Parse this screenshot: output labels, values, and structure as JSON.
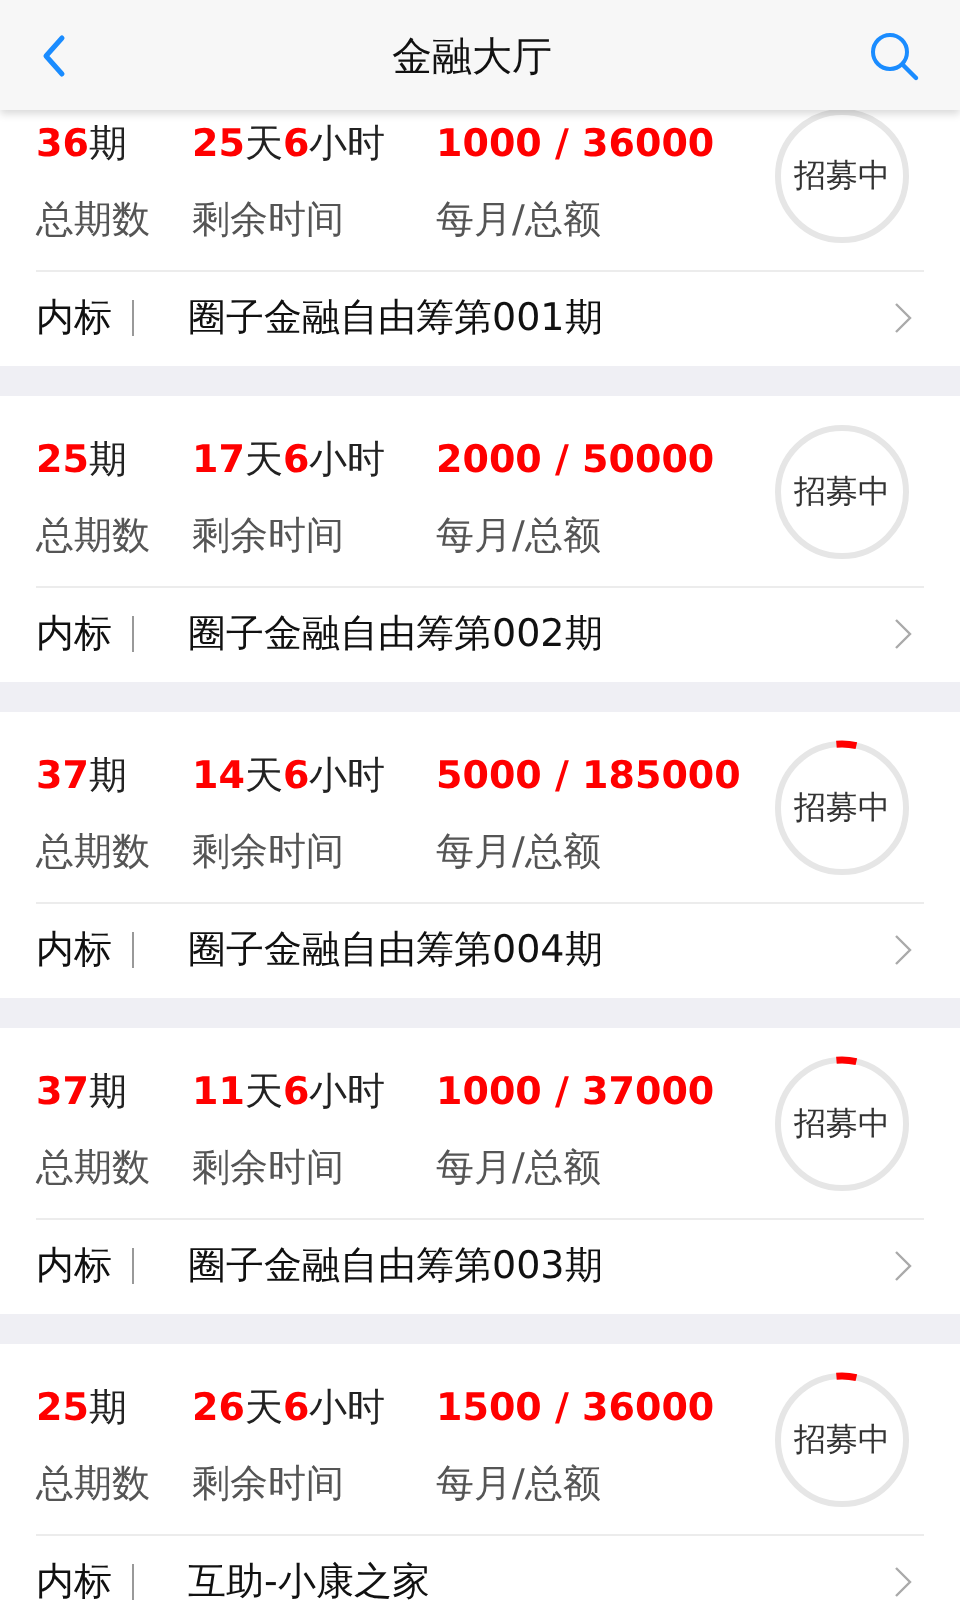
{
  "header": {
    "title": "金融大厅"
  },
  "items": [
    {
      "periods": [
        "36",
        "期"
      ],
      "remaining": [
        "25",
        "天",
        "6",
        "小时"
      ],
      "amount": "1000 / 36000",
      "labels": [
        "总期数",
        "剩余时间",
        "每月/总额"
      ],
      "status": "招募中",
      "started": false,
      "tag": "内标",
      "name": "圈子金融自由筹第001期"
    },
    {
      "periods": [
        "25",
        "期"
      ],
      "remaining": [
        "17",
        "天",
        "6",
        "小时"
      ],
      "amount": "2000 / 50000",
      "labels": [
        "总期数",
        "剩余时间",
        "每月/总额"
      ],
      "status": "招募中",
      "started": false,
      "tag": "内标",
      "name": "圈子金融自由筹第002期"
    },
    {
      "periods": [
        "37",
        "期"
      ],
      "remaining": [
        "14",
        "天",
        "6",
        "小时"
      ],
      "amount": "5000 / 185000",
      "labels": [
        "总期数",
        "剩余时间",
        "每月/总额"
      ],
      "status": "招募中",
      "started": true,
      "tag": "内标",
      "name": "圈子金融自由筹第004期"
    },
    {
      "periods": [
        "37",
        "期"
      ],
      "remaining": [
        "11",
        "天",
        "6",
        "小时"
      ],
      "amount": "1000 / 37000",
      "labels": [
        "总期数",
        "剩余时间",
        "每月/总额"
      ],
      "status": "招募中",
      "started": true,
      "tag": "内标",
      "name": "圈子金融自由筹第003期"
    },
    {
      "periods": [
        "25",
        "期"
      ],
      "remaining": [
        "26",
        "天",
        "6",
        "小时"
      ],
      "amount": "1500 / 36000",
      "labels": [
        "总期数",
        "剩余时间",
        "每月/总额"
      ],
      "status": "招募中",
      "started": true,
      "tag": "内标",
      "name": "互助-小康之家"
    }
  ]
}
